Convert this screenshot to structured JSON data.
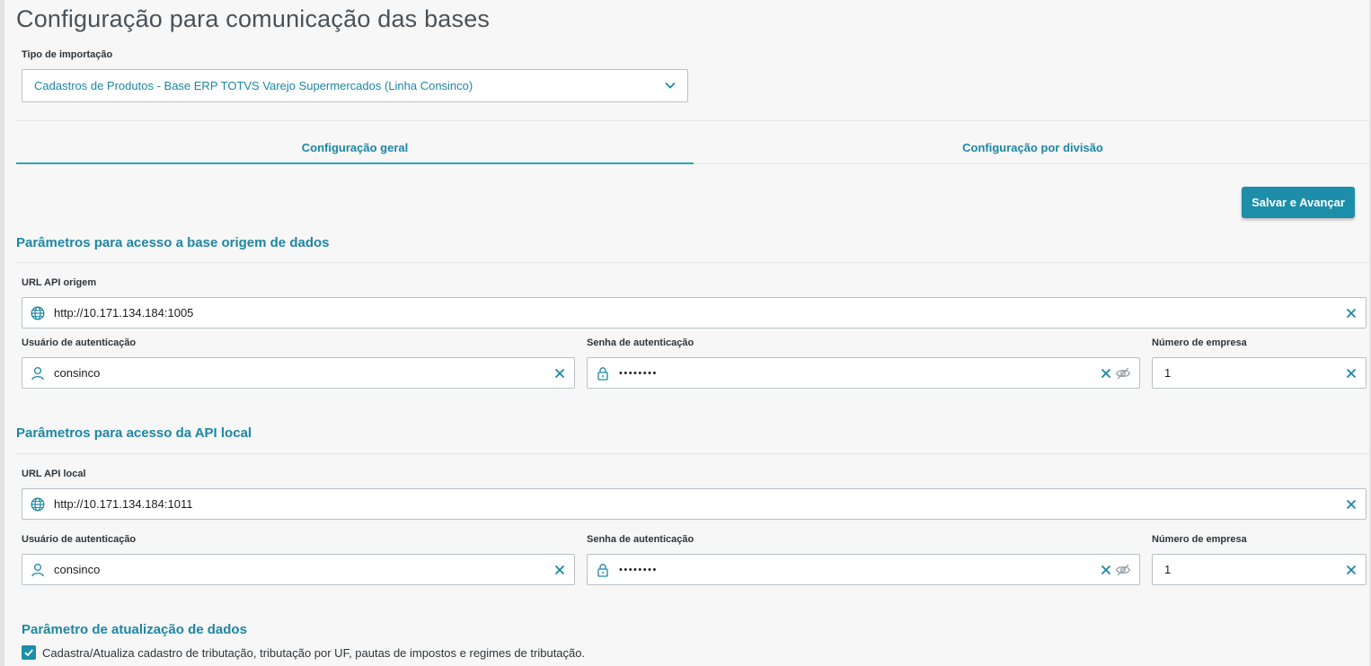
{
  "page": {
    "title": "Configuração para comunicação das bases"
  },
  "import_type": {
    "label": "Tipo de importação",
    "value": "Cadastros de Produtos - Base ERP TOTVS Varejo Supermercados (Linha Consinco)",
    "icon": "chevron-down-icon"
  },
  "tabs": [
    {
      "label": "Configuração geral",
      "active": true
    },
    {
      "label": "Configuração por divisão",
      "active": false
    }
  ],
  "actions": {
    "save_label": "Salvar e Avançar"
  },
  "origin": {
    "title": "Parâmetros para acesso a base origem de dados",
    "url_label": "URL API origem",
    "url_value": "http://10.171.134.184:1005",
    "user_label": "Usuário de autenticação",
    "user_value": "consinco",
    "password_label": "Senha de autenticação",
    "password_value": "••••••••",
    "company_label": "Número de empresa",
    "company_value": "1"
  },
  "local": {
    "title": "Parâmetros para acesso da API local",
    "url_label": "URL API local",
    "url_value": "http://10.171.134.184:1011",
    "user_label": "Usuário de autenticação",
    "user_value": "consinco",
    "password_label": "Senha de autenticação",
    "password_value": "••••••••",
    "company_label": "Número de empresa",
    "company_value": "1"
  },
  "update": {
    "title": "Parâmetro de atualização de dados",
    "checkbox_label": "Cadastra/Atualiza cadastro de tributação, tributação por UF, pautas de impostos e regimes de tributação.",
    "checked": true
  },
  "colors": {
    "accent": "#1e86a3",
    "button": "#1d8ea9",
    "tab_underline": "#2aa3c4",
    "background": "#f7f7f7"
  }
}
